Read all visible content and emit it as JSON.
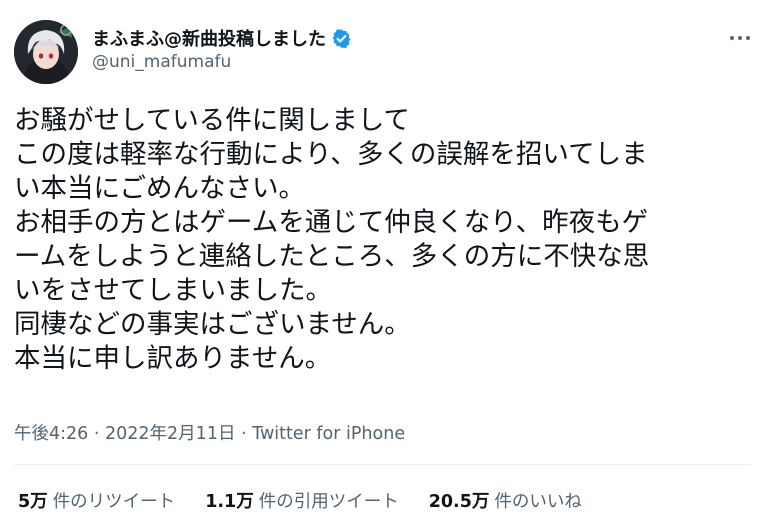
{
  "user": {
    "display_name": "まふまふ@新曲投稿しました",
    "handle": "@uni_mafumafu",
    "verified_badge_color": "#1d9bf0"
  },
  "tweet": {
    "lines": [
      "お騒がせしている件に関しまして",
      "この度は軽率な行動により、多くの誤解を招いてしま",
      "い本当にごめんなさい。",
      "お相手の方とはゲームを通じて仲良くなり、昨夜もゲ",
      "ームをしようと連絡したところ、多くの方に不快な思",
      "いをさせてしまいました。",
      "同棲などの事実はございません。",
      "本当に申し訳ありません。"
    ],
    "time": "午後4:26",
    "separator": " · ",
    "date": "2022年2月11日",
    "source": "Twitter for iPhone"
  },
  "stats": {
    "retweets_count": "5万",
    "retweets_label": "件のリツイート",
    "quotes_count": "1.1万",
    "quotes_label": "件の引用ツイート",
    "likes_count": "20.5万",
    "likes_label": "件のいいね"
  },
  "icons": {
    "verified": "verified-badge-icon",
    "more": "more-options-icon"
  }
}
